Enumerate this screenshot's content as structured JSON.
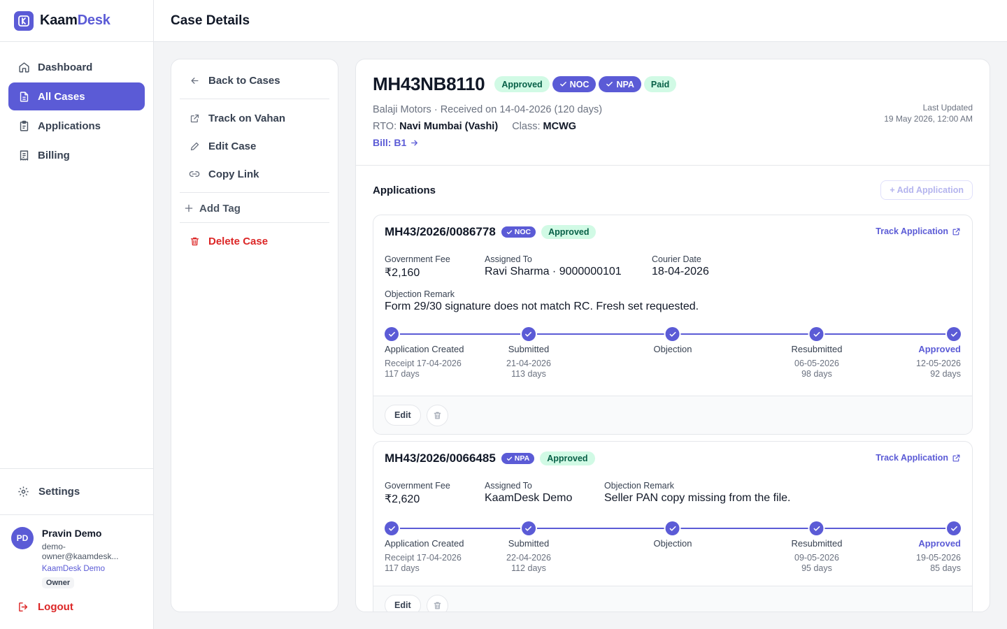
{
  "brand": {
    "part1": "Kaam",
    "part2": "Desk",
    "accent": "#5b5bd6"
  },
  "nav": [
    {
      "label": "Dashboard",
      "icon": "home-icon"
    },
    {
      "label": "All Cases",
      "icon": "document-icon",
      "active": true
    },
    {
      "label": "Applications",
      "icon": "clipboard-icon"
    },
    {
      "label": "Billing",
      "icon": "receipt-icon"
    }
  ],
  "settings_label": "Settings",
  "user": {
    "initials": "PD",
    "name": "Pravin Demo",
    "email": "demo-owner@kaamdesk...",
    "org": "KaamDesk Demo",
    "role": "Owner"
  },
  "logout_label": "Logout",
  "page_title": "Case Details",
  "actions": {
    "back": "Back to Cases",
    "track": "Track on Vahan",
    "edit": "Edit Case",
    "copy": "Copy Link",
    "add_tag": "Add Tag",
    "delete": "Delete Case"
  },
  "case": {
    "number": "MH43NB8110",
    "badges": {
      "status": "Approved",
      "noc": "NOC",
      "npa": "NPA",
      "paid": "Paid"
    },
    "subtitle": "Balaji Motors · Received on 14-04-2026 (120 days)",
    "rto_label": "RTO:",
    "rto": "Navi Mumbai (Vashi)",
    "class_label": "Class:",
    "class": "MCWG",
    "bill": "Bill: B1",
    "last_updated_label": "Last Updated",
    "last_updated": "19 May 2026, 12:00 AM"
  },
  "applications": {
    "title": "Applications",
    "add_label": "+ Add Application",
    "track_label": "Track Application",
    "edit_label": "Edit",
    "items": [
      {
        "number": "MH43/2026/0086778",
        "type": "NOC",
        "status": "Approved",
        "fee_label": "Government Fee",
        "fee": "₹2,160",
        "assigned_label": "Assigned To",
        "assigned": "Ravi Sharma · 9000000101",
        "courier_label": "Courier Date",
        "courier": "18-04-2026",
        "remark_label": "Objection Remark",
        "remark": "Form 29/30 signature does not match RC. Fresh set requested.",
        "steps": [
          {
            "label": "Application Created",
            "line1": "Receipt 17-04-2026",
            "line2": "117 days"
          },
          {
            "label": "Submitted",
            "line1": "21-04-2026",
            "line2": "113 days"
          },
          {
            "label": "Objection",
            "line1": "",
            "line2": ""
          },
          {
            "label": "Resubmitted",
            "line1": "06-05-2026",
            "line2": "98 days"
          },
          {
            "label": "Approved",
            "line1": "12-05-2026",
            "line2": "92 days"
          }
        ]
      },
      {
        "number": "MH43/2026/0066485",
        "type": "NPA",
        "status": "Approved",
        "fee_label": "Government Fee",
        "fee": "₹2,620",
        "assigned_label": "Assigned To",
        "assigned": "KaamDesk Demo",
        "remark_label": "Objection Remark",
        "remark": "Seller PAN copy missing from the file.",
        "steps": [
          {
            "label": "Application Created",
            "line1": "Receipt 17-04-2026",
            "line2": "117 days"
          },
          {
            "label": "Submitted",
            "line1": "22-04-2026",
            "line2": "112 days"
          },
          {
            "label": "Objection",
            "line1": "",
            "line2": ""
          },
          {
            "label": "Resubmitted",
            "line1": "09-05-2026",
            "line2": "95 days"
          },
          {
            "label": "Approved",
            "line1": "19-05-2026",
            "line2": "85 days"
          }
        ]
      }
    ]
  }
}
